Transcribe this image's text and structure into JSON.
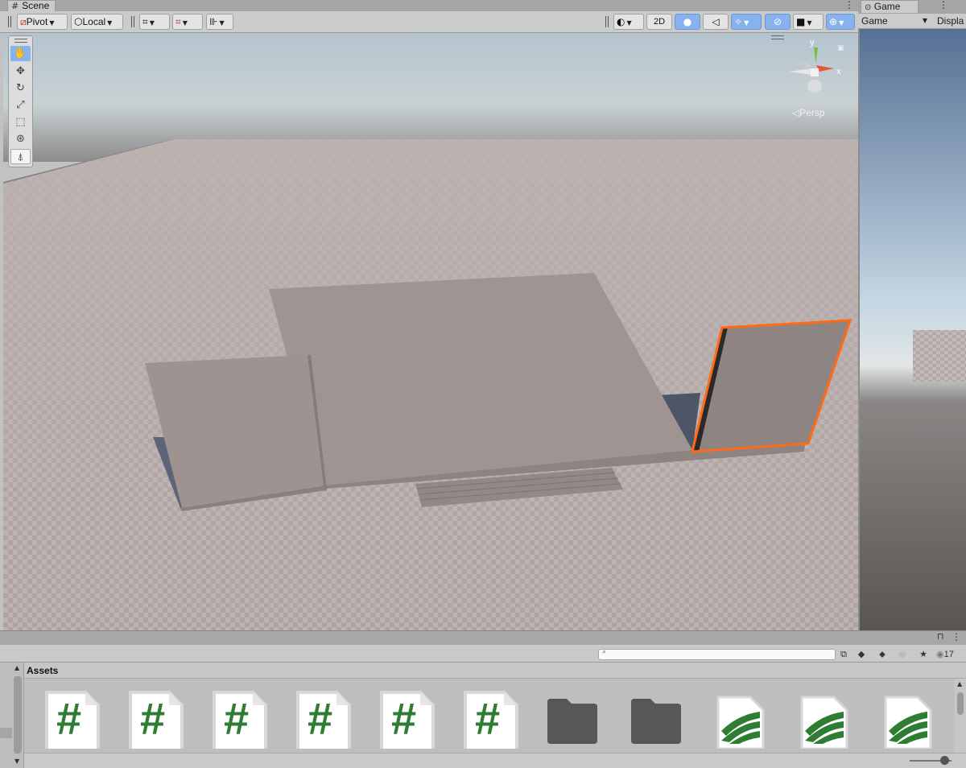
{
  "scene_tab": {
    "icon": "#",
    "label": "Scene"
  },
  "toolbar": {
    "pivot_label": "Pivot",
    "local_label": "Local",
    "btn_2d": "2D"
  },
  "game_tab": {
    "label": "Game"
  },
  "game_toolbar": {
    "view_select": "Game",
    "display_label": "Displa"
  },
  "viewport": {
    "persp_label": "Persp",
    "gizmo_axes": {
      "x": "x",
      "y": "y"
    },
    "selection_outline_color": "#ff6a13"
  },
  "project": {
    "breadcrumb": "Assets",
    "visible_count": "17",
    "assets": [
      {
        "type": "script",
        "glyph": "#"
      },
      {
        "type": "script",
        "glyph": "#"
      },
      {
        "type": "script",
        "glyph": "#"
      },
      {
        "type": "script",
        "glyph": "#"
      },
      {
        "type": "script",
        "glyph": "#"
      },
      {
        "type": "script",
        "glyph": "#"
      },
      {
        "type": "folder"
      },
      {
        "type": "folder"
      },
      {
        "type": "terrain-layer"
      },
      {
        "type": "terrain-layer"
      },
      {
        "type": "terrain-layer"
      }
    ]
  },
  "colors": {
    "accent_blue": "#87b2ee",
    "script_glyph": "#2e7d32",
    "folder": "#575757"
  }
}
